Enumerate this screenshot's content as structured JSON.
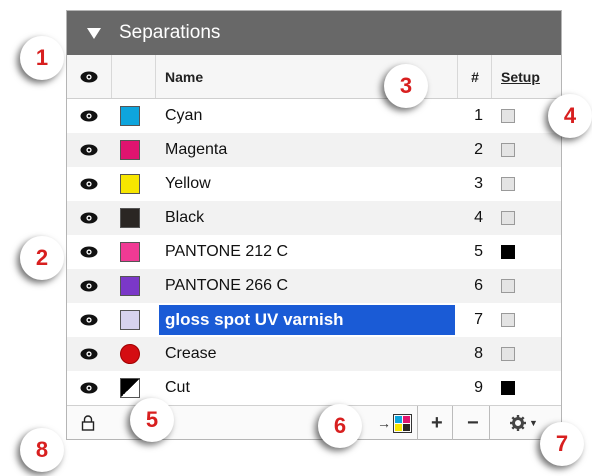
{
  "panel": {
    "title": "Separations"
  },
  "header": {
    "visibility_icon": "eye-icon",
    "name": "Name",
    "number": "#",
    "setup": "Setup"
  },
  "separations": [
    {
      "name": "Cyan",
      "number": "1",
      "color": "#0ea5dd",
      "shape": "square",
      "setup": false,
      "selected": false
    },
    {
      "name": "Magenta",
      "number": "2",
      "color": "#e0146f",
      "shape": "square",
      "setup": false,
      "selected": false
    },
    {
      "name": "Yellow",
      "number": "3",
      "color": "#f7e600",
      "shape": "square",
      "setup": false,
      "selected": false
    },
    {
      "name": "Black",
      "number": "4",
      "color": "#2a2623",
      "shape": "square",
      "setup": false,
      "selected": false
    },
    {
      "name": "PANTONE 212 C",
      "number": "5",
      "color": "#f03a94",
      "shape": "square",
      "setup": true,
      "selected": false
    },
    {
      "name": "PANTONE 266 C",
      "number": "6",
      "color": "#7b38c8",
      "shape": "square",
      "setup": false,
      "selected": false
    },
    {
      "name": "gloss spot UV varnish",
      "number": "7",
      "color": "#d7d3ee",
      "shape": "square",
      "setup": false,
      "selected": true
    },
    {
      "name": "Crease",
      "number": "8",
      "color": "#d40d12",
      "shape": "circle",
      "setup": false,
      "selected": false
    },
    {
      "name": "Cut",
      "number": "9",
      "color": "#000000",
      "shape": "diagonal",
      "setup": true,
      "selected": false
    }
  ],
  "footer": {
    "lock_icon": "lock-icon",
    "merge_icon": "merge-to-process-icon",
    "add_label": "+",
    "remove_label": "−",
    "settings_icon": "gear-icon"
  },
  "callouts": [
    "1",
    "2",
    "3",
    "4",
    "5",
    "6",
    "7",
    "8"
  ],
  "colors": {
    "titlebar": "#686868",
    "selection": "#1a5bd6",
    "callout_text": "#d81f1f"
  }
}
